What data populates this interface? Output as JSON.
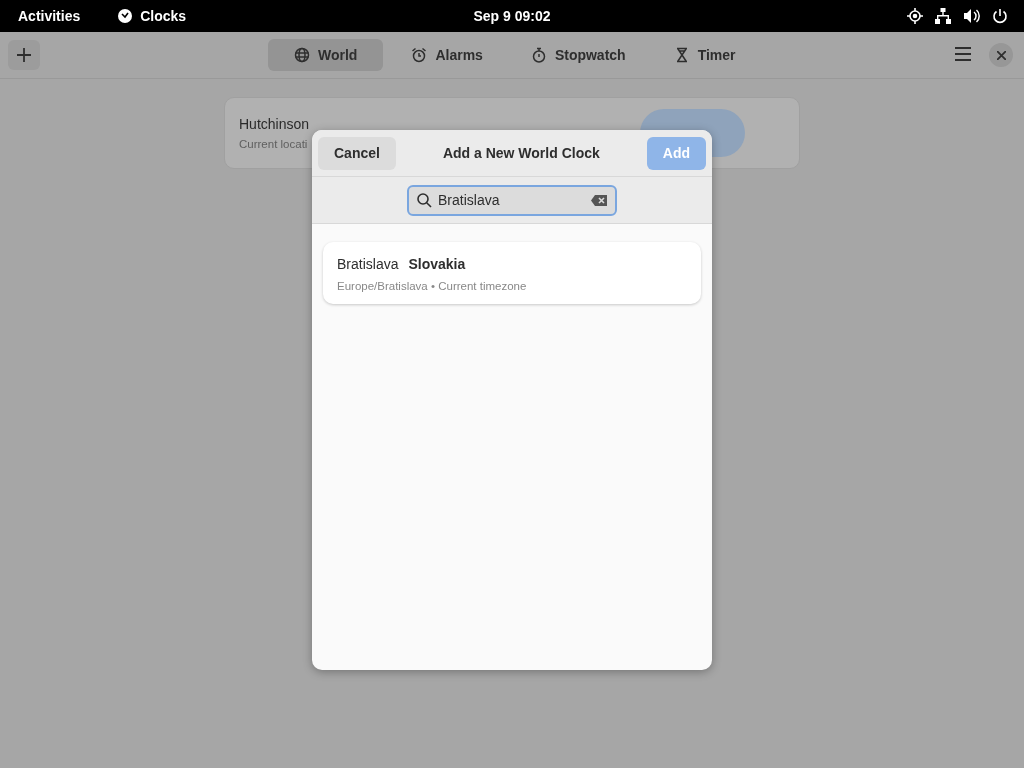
{
  "top_bar": {
    "activities": "Activities",
    "app_name": "Clocks",
    "datetime": "Sep 9  09:02"
  },
  "tabs": [
    {
      "label": "World",
      "selected": true
    },
    {
      "label": "Alarms",
      "selected": false
    },
    {
      "label": "Stopwatch",
      "selected": false
    },
    {
      "label": "Timer",
      "selected": false
    }
  ],
  "world_clock": {
    "city": "Hutchinson",
    "subtitle": "Current locati"
  },
  "dialog": {
    "title": "Add a New World Clock",
    "cancel": "Cancel",
    "add": {
      "label": "Add",
      "disabled": true
    },
    "search": {
      "value": "Bratislava"
    },
    "results": [
      {
        "city": "Bratislava",
        "country": "Slovakia",
        "detail": "Europe/Bratislava • Current timezone"
      }
    ]
  }
}
